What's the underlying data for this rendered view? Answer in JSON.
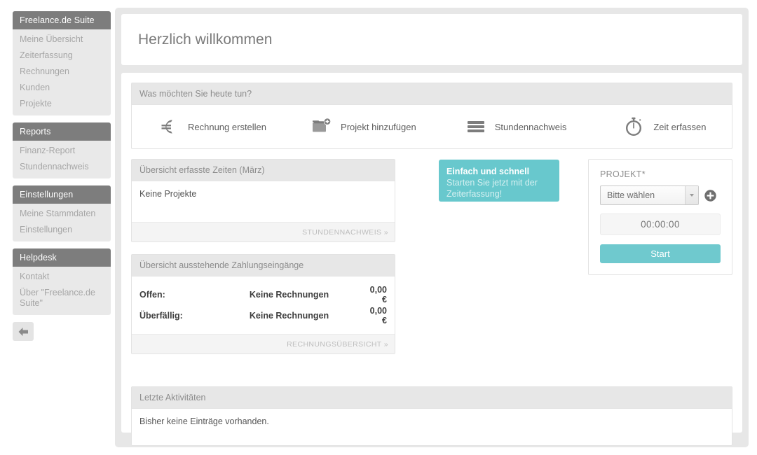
{
  "sidebar": {
    "groups": [
      {
        "title": "Freelance.de Suite",
        "items": [
          {
            "label": "Meine Übersicht"
          },
          {
            "label": "Zeiterfassung"
          },
          {
            "label": "Rechnungen"
          },
          {
            "label": "Kunden"
          },
          {
            "label": "Projekte"
          }
        ]
      },
      {
        "title": "Reports",
        "items": [
          {
            "label": "Finanz-Report"
          },
          {
            "label": "Stundennachweis"
          }
        ]
      },
      {
        "title": "Einstellungen",
        "items": [
          {
            "label": "Meine Stammdaten"
          },
          {
            "label": "Einstellungen"
          }
        ]
      },
      {
        "title": "Helpdesk",
        "items": [
          {
            "label": "Kontakt"
          },
          {
            "label": "Über \"Freelance.de Suite\""
          }
        ]
      }
    ],
    "collapse_icon": "arrow-left-icon"
  },
  "welcome": {
    "title": "Herzlich willkommen"
  },
  "actions": {
    "heading": "Was möchten Sie heute tun?",
    "items": [
      {
        "label": "Rechnung erstellen",
        "icon": "euro-icon"
      },
      {
        "label": "Projekt hinzufügen",
        "icon": "folder-plus-icon"
      },
      {
        "label": "Stundennachweis",
        "icon": "list-lines-icon"
      },
      {
        "label": "Zeit erfassen",
        "icon": "stopwatch-icon"
      }
    ]
  },
  "times_panel": {
    "heading": "Übersicht erfasste Zeiten (März)",
    "empty_text": "Keine Projekte",
    "footer_link": "STUNDENNACHWEIS »"
  },
  "payments_panel": {
    "heading": "Übersicht ausstehende Zahlungseingänge",
    "rows": [
      {
        "label": "Offen:",
        "status": "Keine Rechnungen",
        "amount": "0,00 €"
      },
      {
        "label": "Überfällig:",
        "status": "Keine Rechnungen",
        "amount": "0,00 €"
      }
    ],
    "footer_link": "RECHNUNGSÜBERSICHT »"
  },
  "promo": {
    "title": "Einfach und schnell",
    "text": "Starten Sie jetzt mit der Zeiterfassung!",
    "color": "#68c8cd"
  },
  "timer": {
    "field_label": "PROJEKT*",
    "select_value": "Bitte wählen",
    "select_options": [
      "Bitte wählen"
    ],
    "add_icon": "plus-circle-icon",
    "clock": "00:00:00",
    "start_label": "Start",
    "accent_color": "#6fc9ce"
  },
  "activities_panel": {
    "heading": "Letzte Aktivitäten",
    "empty_text": "Bisher keine Einträge vorhanden."
  }
}
